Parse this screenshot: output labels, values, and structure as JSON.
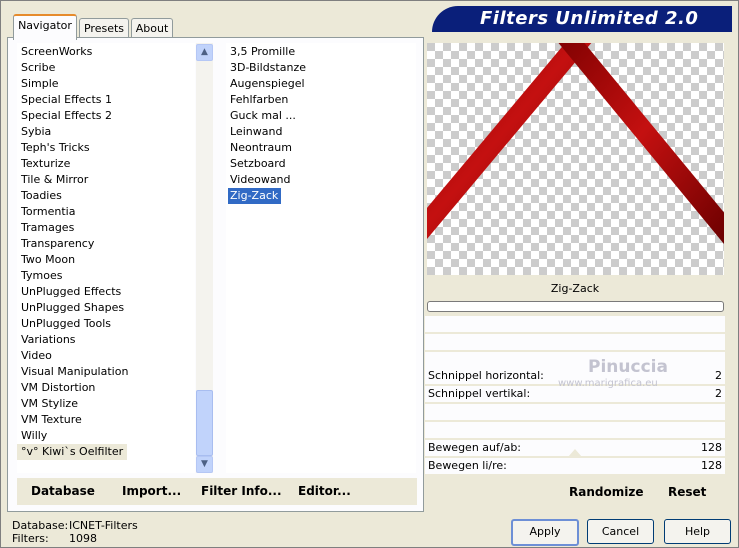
{
  "header": {
    "title": "Filters Unlimited 2.0"
  },
  "tabs": [
    {
      "label": "Navigator",
      "active": true
    },
    {
      "label": "Presets",
      "active": false
    },
    {
      "label": "About",
      "active": false
    }
  ],
  "categories": [
    "ScreenWorks",
    "Scribe",
    "Simple",
    "Special Effects 1",
    "Special Effects 2",
    "Sybia",
    "Teph's Tricks",
    "Texturize",
    "Tile & Mirror",
    "Toadies",
    "Tormentia",
    "Tramages",
    "Transparency",
    "Two Moon",
    "Tymoes",
    "UnPlugged Effects",
    "UnPlugged Shapes",
    "UnPlugged Tools",
    "Variations",
    "Video",
    "Visual Manipulation",
    "VM Distortion",
    "VM Stylize",
    "VM Texture",
    "Willy",
    "°v° Kiwi`s Oelfilter"
  ],
  "selected_category": "°v° Kiwi`s Oelfilter",
  "filters": [
    "3,5 Promille",
    "3D-Bildstanze",
    "Augenspiegel",
    "Fehlfarben",
    "Guck mal ...",
    "Leinwand",
    "Neontraum",
    "Setzboard",
    "Videowand",
    "Zig-Zack"
  ],
  "selected_filter": "Zig-Zack",
  "left_buttons": {
    "database": "Database",
    "import": "Import...",
    "filter_info": "Filter Info...",
    "editor": "Editor..."
  },
  "preview": {
    "label": "Zig-Zack",
    "progress": 0.0,
    "accent": "#b50d0d"
  },
  "watermark": {
    "name": "Pinuccia",
    "url": "www.marigrafica.eu"
  },
  "params": [
    {
      "label": "Schnippel horizontal:",
      "value": "2"
    },
    {
      "label": "Schnippel vertikal:",
      "value": "2"
    },
    {
      "label": "Bewegen auf/ab:",
      "value": "128"
    },
    {
      "label": "Bewegen li/re:",
      "value": "128"
    }
  ],
  "right_buttons": {
    "randomize": "Randomize",
    "reset": "Reset"
  },
  "status": {
    "db_label": "Database:",
    "db_value": "ICNET-Filters",
    "filters_label": "Filters:",
    "filters_value": "1098"
  },
  "dialog_buttons": {
    "apply": "Apply",
    "cancel": "Cancel",
    "help": "Help"
  }
}
